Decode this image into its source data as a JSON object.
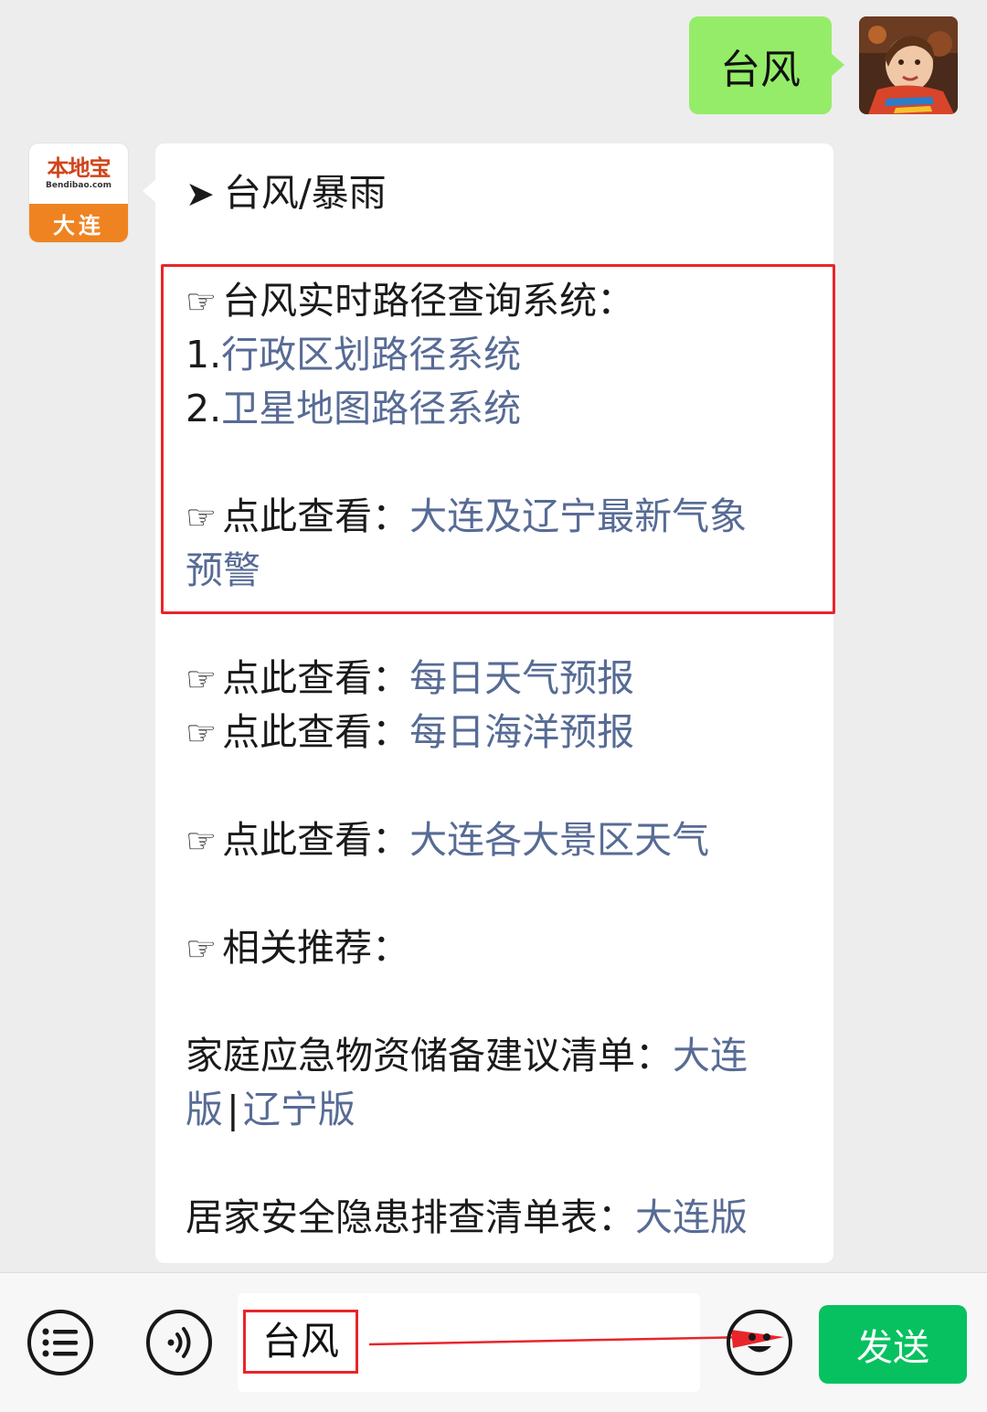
{
  "user_message": {
    "text": "台风"
  },
  "bot": {
    "logo_name": "本地宝",
    "logo_domain": "Bendibao.com",
    "logo_city": "大连"
  },
  "reply": {
    "arrow_symbol": "➤",
    "hand_symbol": "☞",
    "heading": "台风/暴雨",
    "system_title": "台风实时路径查询系统：",
    "item1_num": "1.",
    "item1_link": "行政区划路径系统",
    "item2_num": "2.",
    "item2_link": "卫星地图路径系统",
    "view_label": "点此查看：",
    "warning_link_line1": "大连及辽宁最新气象",
    "warning_link_line2": "预警",
    "daily_weather_link": "每日天气预报",
    "daily_ocean_link": "每日海洋预报",
    "scenic_link": "大连各大景区天气",
    "related_label": "相关推荐：",
    "emergency_text": "家庭应急物资储备建议清单：",
    "emergency_link1_a": "大连",
    "emergency_link1_b": "版",
    "separator": "|",
    "emergency_link2": "辽宁版",
    "safety_text": "居家安全隐患排查清单表：",
    "safety_link": "大连版"
  },
  "input_bar": {
    "menu_icon": "list-icon",
    "voice_icon": "voice-icon",
    "typed_text": "台风",
    "emoji_icon": "smiley-icon",
    "send_label": "发送"
  },
  "colors": {
    "user_bubble": "#95ec69",
    "link": "#576b95",
    "highlight": "#e8252b",
    "send_button": "#07c160"
  }
}
